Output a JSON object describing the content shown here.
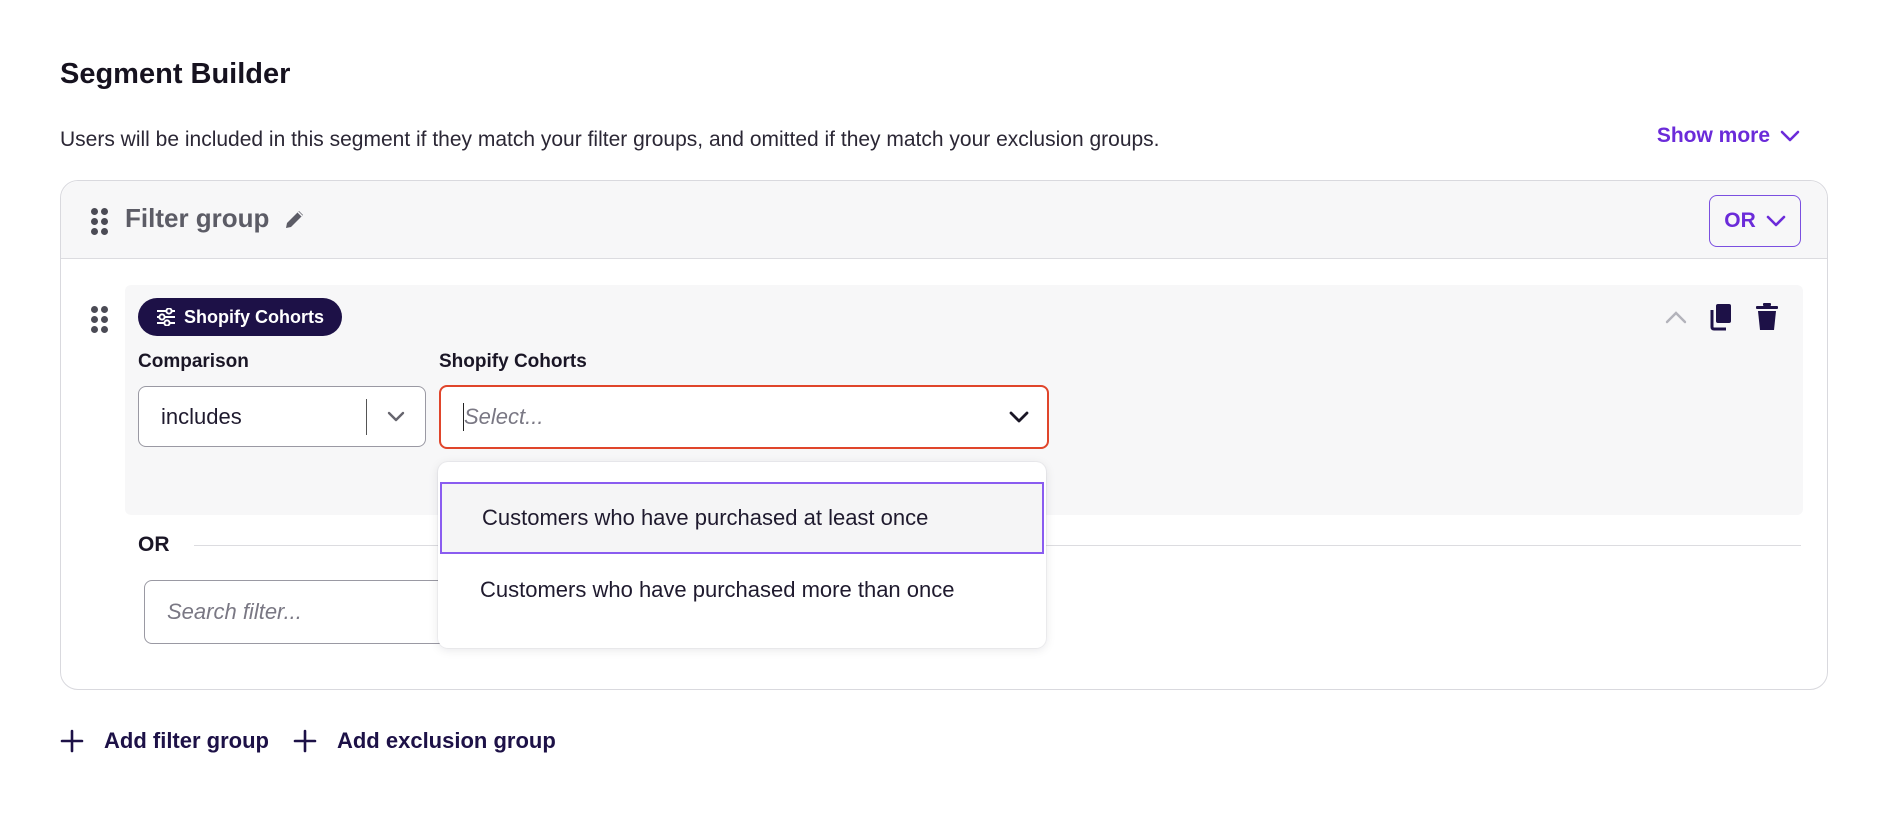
{
  "header": {
    "title": "Segment Builder",
    "description": "Users will be included in this segment if they match your filter groups, and omitted if they match your exclusion groups.",
    "show_more_label": "Show more"
  },
  "filter_group": {
    "name": "Filter group",
    "operator": "OR",
    "filter": {
      "pill_label": "Shopify Cohorts",
      "comparison_label": "Comparison",
      "comparison_value": "includes",
      "cohorts_label": "Shopify Cohorts",
      "cohorts_placeholder": "Select...",
      "cohort_options": [
        "Customers who have purchased at least once",
        "Customers who have purchased more than once"
      ]
    },
    "divider_label": "OR",
    "search_placeholder": "Search filter..."
  },
  "actions": {
    "add_filter_group": "Add filter group",
    "add_exclusion_group": "Add exclusion group"
  },
  "colors": {
    "accent": "#6b2bd9",
    "pill_bg": "#1d1147",
    "error_border": "#e0452b",
    "option_highlight": "#8a5cf0"
  }
}
